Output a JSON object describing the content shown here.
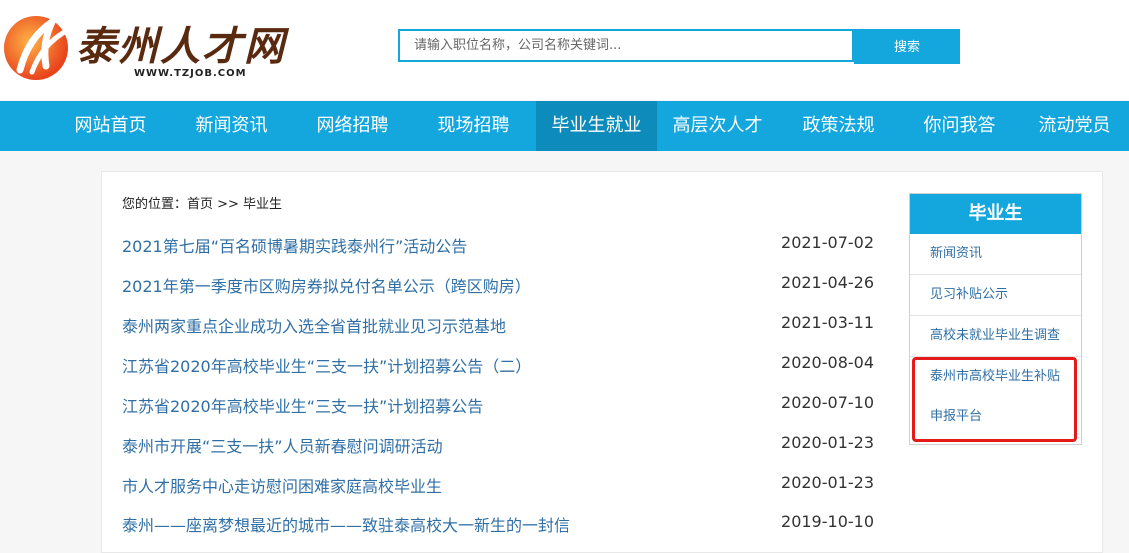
{
  "header": {
    "logo_text": "泰州人才网",
    "logo_url": "WWW.TZJOB.COM",
    "search_placeholder": "请输入职位名称，公司名称关键词...",
    "search_button": "搜索"
  },
  "nav": {
    "items": [
      "网站首页",
      "新闻资讯",
      "网络招聘",
      "现场招聘",
      "毕业生就业",
      "高层次人才",
      "政策法规",
      "你问我答",
      "流动党员"
    ],
    "active_index": 4
  },
  "breadcrumb": "您的位置：首页 >> 毕业生",
  "news": [
    {
      "title": "2021第七届“百名硕博暑期实践泰州行”活动公告",
      "date": "2021-07-02"
    },
    {
      "title": "2021年第一季度市区购房券拟兑付名单公示（跨区购房）",
      "date": "2021-04-26"
    },
    {
      "title": "泰州两家重点企业成功入选全省首批就业见习示范基地",
      "date": "2021-03-11"
    },
    {
      "title": "江苏省2020年高校毕业生“三支一扶”计划招募公告（二）",
      "date": "2020-08-04"
    },
    {
      "title": "江苏省2020年高校毕业生“三支一扶”计划招募公告",
      "date": "2020-07-10"
    },
    {
      "title": "泰州市开展“三支一扶”人员新春慰问调研活动",
      "date": "2020-01-23"
    },
    {
      "title": "市人才服务中心走访慰问困难家庭高校毕业生",
      "date": "2020-01-23"
    },
    {
      "title": "泰州——座离梦想最近的城市——致驻泰高校大一新生的一封信",
      "date": "2019-10-10"
    }
  ],
  "sidebar": {
    "title": "毕业生",
    "items": [
      "新闻资讯",
      "见习补贴公示",
      "高校未就业毕业生调查",
      "泰州市高校毕业生补贴",
      "申报平台"
    ]
  },
  "colors": {
    "accent": "#13a7dd",
    "active_nav": "#0d8cbc",
    "link": "#2f6fa5",
    "highlight": "#e51b1b"
  }
}
